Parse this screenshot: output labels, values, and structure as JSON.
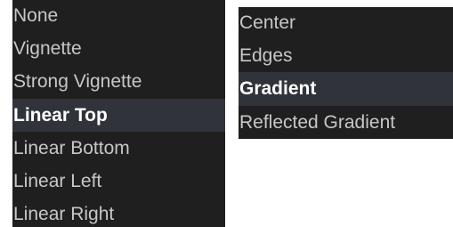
{
  "left_menu": {
    "items": [
      {
        "label": "None",
        "selected": false
      },
      {
        "label": "Vignette",
        "selected": false
      },
      {
        "label": "Strong Vignette",
        "selected": false
      },
      {
        "label": "Linear Top",
        "selected": true
      },
      {
        "label": "Linear Bottom",
        "selected": false
      },
      {
        "label": "Linear Left",
        "selected": false
      },
      {
        "label": "Linear Right",
        "selected": false
      }
    ]
  },
  "right_menu": {
    "items": [
      {
        "label": "Center",
        "selected": false
      },
      {
        "label": "Edges",
        "selected": false
      },
      {
        "label": "Gradient",
        "selected": true
      },
      {
        "label": "Reflected Gradient",
        "selected": false
      }
    ]
  },
  "colors": {
    "menu_background": "#1f1f1f",
    "selected_background": "#30343a",
    "item_text": "#c7c7c7",
    "selected_text": "#ffffff"
  }
}
